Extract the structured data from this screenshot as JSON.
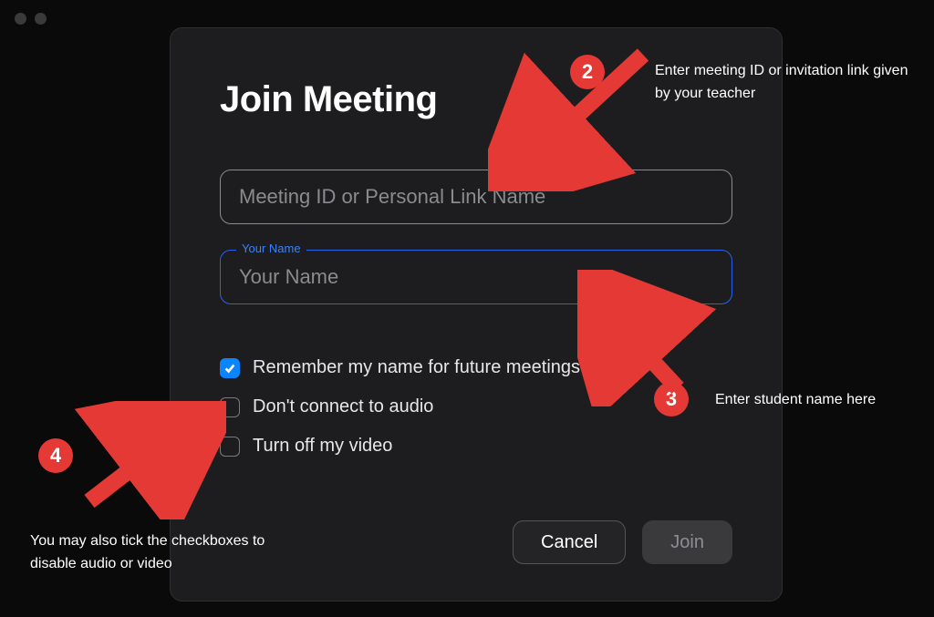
{
  "dialog": {
    "title": "Join Meeting",
    "meeting_id_placeholder": "Meeting ID or Personal Link Name",
    "name_float_label": "Your Name",
    "name_placeholder": "Your Name",
    "checkboxes": {
      "remember": {
        "label": "Remember my name for future meetings",
        "checked": true
      },
      "no_audio": {
        "label": "Don't connect to audio",
        "checked": false
      },
      "no_video": {
        "label": "Turn off my video",
        "checked": false
      }
    },
    "buttons": {
      "cancel": "Cancel",
      "join": "Join"
    }
  },
  "annotations": {
    "b2": "2",
    "b3": "3",
    "b4": "4",
    "text_top": "Enter meeting ID  or invitation link given by your teacher",
    "text_right": "Enter student name here",
    "text_left": "You may also tick the checkboxes to disable audio or video"
  }
}
